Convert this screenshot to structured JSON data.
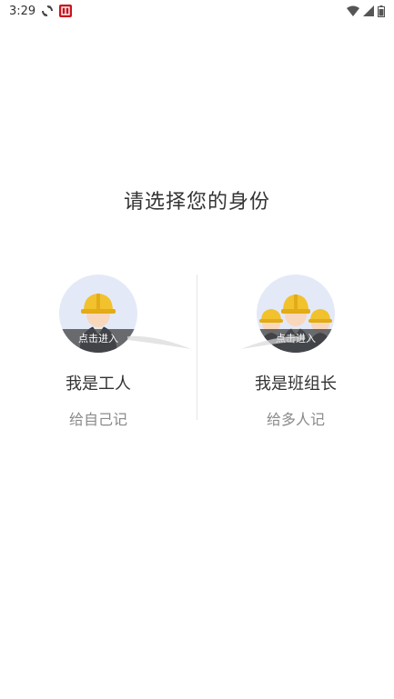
{
  "status_bar": {
    "time": "3:29",
    "left_icons": [
      "sync-icon",
      "app-notification-icon"
    ],
    "right_icons": [
      "wifi-icon",
      "signal-icon",
      "battery-icon"
    ]
  },
  "page": {
    "title": "请选择您的身份"
  },
  "roles": [
    {
      "name": "我是工人",
      "subtitle": "给自己记",
      "enter_label": "点击进入",
      "icon": "single-worker-icon"
    },
    {
      "name": "我是班组长",
      "subtitle": "给多人记",
      "enter_label": "点击进入",
      "icon": "worker-group-icon"
    }
  ],
  "colors": {
    "avatar_bg": "#e4e9f8",
    "helmet": "#f2c22e",
    "title_text": "#333333",
    "sub_text": "#8a8a8a"
  }
}
